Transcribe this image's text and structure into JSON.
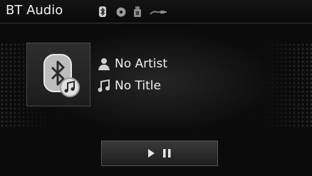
{
  "statusbar": {
    "title": "BT Audio",
    "icons": [
      "bluetooth-icon",
      "disc-icon",
      "usb-icon",
      "aux-cable-icon"
    ]
  },
  "track": {
    "artist": "No Artist",
    "title": "No Title"
  },
  "controls": {
    "play_pause_icon": "play-pause-icon"
  }
}
